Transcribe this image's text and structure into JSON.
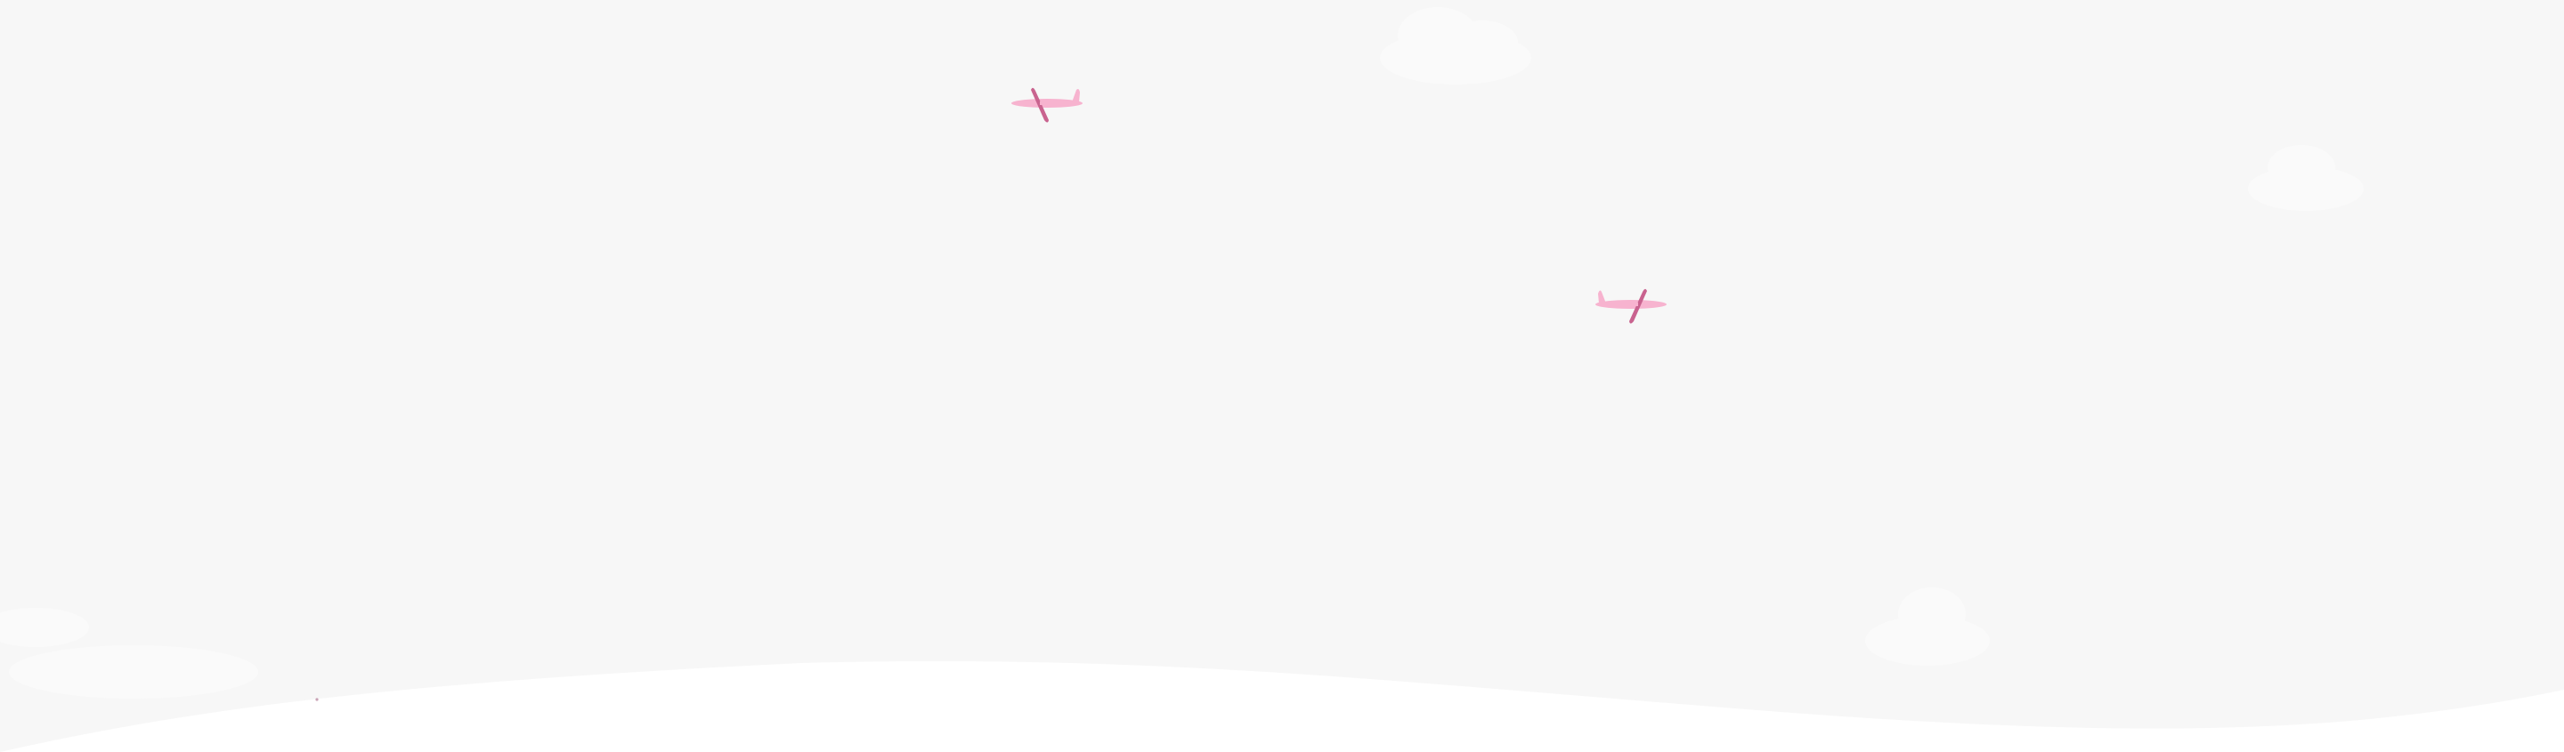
{
  "scene": {
    "sky_color": "#f7f7f7",
    "ground_color": "#ffffff",
    "cloud_color": "#fafafa",
    "plane_body_color": "#f7b3cf",
    "plane_wing_color": "#c9638f",
    "icons": [
      "airplane-icon",
      "cloud-icon",
      "hill-wave-icon"
    ]
  }
}
